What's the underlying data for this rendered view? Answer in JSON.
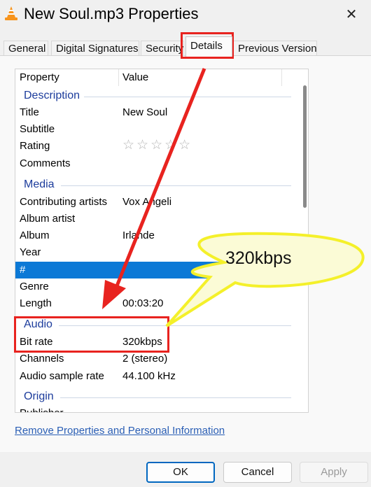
{
  "window": {
    "title": "New Soul.mp3 Properties",
    "close_glyph": "✕"
  },
  "tabs": [
    {
      "label": "General"
    },
    {
      "label": "Digital Signatures"
    },
    {
      "label": "Security"
    },
    {
      "label": "Details",
      "active": true
    },
    {
      "label": "Previous Versions"
    }
  ],
  "list": {
    "headers": {
      "property": "Property",
      "value": "Value"
    },
    "sections": {
      "description": "Description",
      "media": "Media",
      "audio": "Audio",
      "origin": "Origin"
    },
    "rows": {
      "title": {
        "property": "Title",
        "value": "New Soul"
      },
      "subtitle": {
        "property": "Subtitle",
        "value": ""
      },
      "rating": {
        "property": "Rating",
        "value": "☆☆☆☆☆"
      },
      "comments": {
        "property": "Comments",
        "value": ""
      },
      "contributing_artists": {
        "property": "Contributing artists",
        "value": "Vox Angeli"
      },
      "album_artist": {
        "property": "Album artist",
        "value": ""
      },
      "album": {
        "property": "Album",
        "value": "Irlande"
      },
      "year": {
        "property": "Year",
        "value": ""
      },
      "track": {
        "property": "#",
        "value": ""
      },
      "genre": {
        "property": "Genre",
        "value": ""
      },
      "length": {
        "property": "Length",
        "value": "00:03:20"
      },
      "bit_rate": {
        "property": "Bit rate",
        "value": "320kbps"
      },
      "channels": {
        "property": "Channels",
        "value": "2 (stereo)"
      },
      "sample_rate": {
        "property": "Audio sample rate",
        "value": "44.100 kHz"
      },
      "publisher": {
        "property": "Publisher",
        "value": ""
      }
    }
  },
  "remove_link": "Remove Properties and Personal Information",
  "buttons": {
    "ok": "OK",
    "cancel": "Cancel",
    "apply": "Apply"
  },
  "annotation": {
    "callout": "320kbps",
    "highlight_color": "#e8231f",
    "callout_color": "#f4f02a"
  },
  "colors": {
    "selection": "#0c79d6",
    "section_text": "#1c3c9c",
    "link": "#2b5fb5",
    "ok_border": "#0067c0"
  }
}
